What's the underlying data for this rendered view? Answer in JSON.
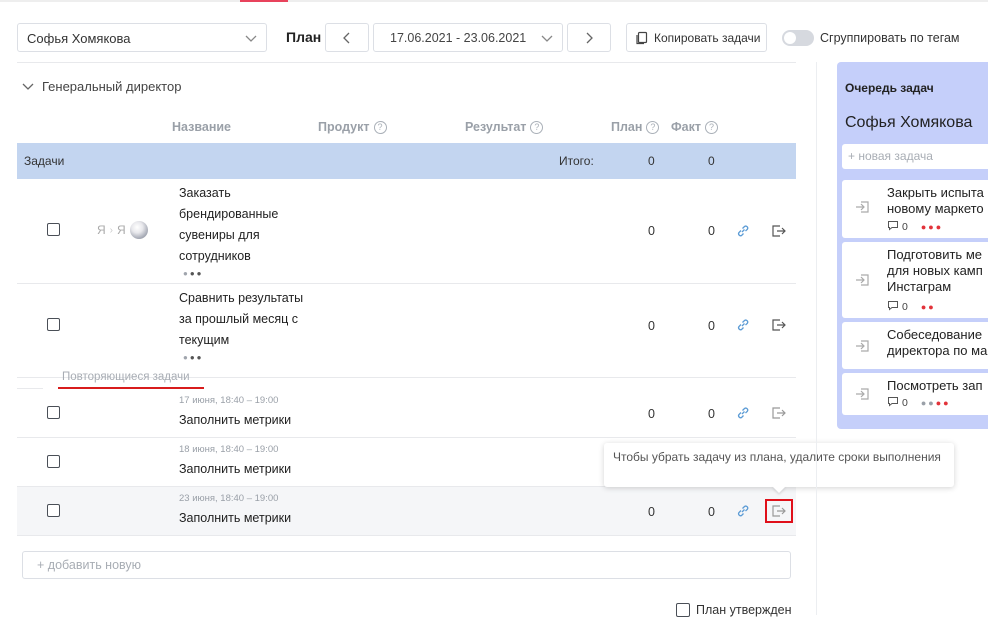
{
  "toolbar": {
    "user": "Софья Хомякова",
    "plan_label": "План",
    "date_range": "17.06.2021 - 23.06.2021",
    "copy_tasks": "Копировать задачи",
    "group_by_tags": "Сгруппировать по тегам"
  },
  "group": {
    "title": "Генеральный директор"
  },
  "columns": {
    "name": "Название",
    "product": "Продукт",
    "result": "Результат",
    "plan": "План",
    "fact": "Факт"
  },
  "tasks_band": {
    "label": "Задачи",
    "total_label": "Итого:",
    "plan_total": "0",
    "fact_total": "0"
  },
  "tasks": [
    {
      "assignee_from": "Я",
      "assignee_to": "Я",
      "lines": [
        "Заказать",
        "брендированные",
        "сувениры для",
        "сотрудников"
      ],
      "plan": "0",
      "fact": "0"
    },
    {
      "lines": [
        "Сравнить результаты",
        "за прошлый месяц с",
        "текущим"
      ],
      "plan": "0",
      "fact": "0"
    }
  ],
  "recurring": {
    "label": "Повторяющиеся задачи",
    "items": [
      {
        "when": "17 июня, 18:40 – 19:00",
        "name": "Заполнить метрики",
        "plan": "0",
        "fact": "0"
      },
      {
        "when": "18 июня, 18:40 – 19:00",
        "name": "Заполнить метрики"
      },
      {
        "when": "23 июня, 18:40 – 19:00",
        "name": "Заполнить метрики",
        "plan": "0",
        "fact": "0"
      }
    ]
  },
  "tooltip": "Чтобы убрать задачу из плана, удалите сроки выполнения",
  "add_new": "+ добавить новую",
  "plan_approved": "План утвержден",
  "queue": {
    "title": "Очередь задач",
    "user": "Софья Хомякова",
    "new_task": "+ новая задача",
    "cards": [
      {
        "lines": [
          "Закрыть испыта",
          "новому маркето"
        ],
        "comments": "0"
      },
      {
        "lines": [
          "Подготовить ме",
          "для новых камп",
          "Инстаграм"
        ],
        "comments": "0"
      },
      {
        "lines": [
          "Собеседование",
          "директора по ма"
        ]
      },
      {
        "lines": [
          "Посмотреть зап"
        ],
        "comments": "0"
      }
    ]
  },
  "colors": {
    "accent": "#e8435c",
    "band": "#c3d5f0",
    "queue_bg": "#c5cffa",
    "highlight": "#e0101a"
  }
}
